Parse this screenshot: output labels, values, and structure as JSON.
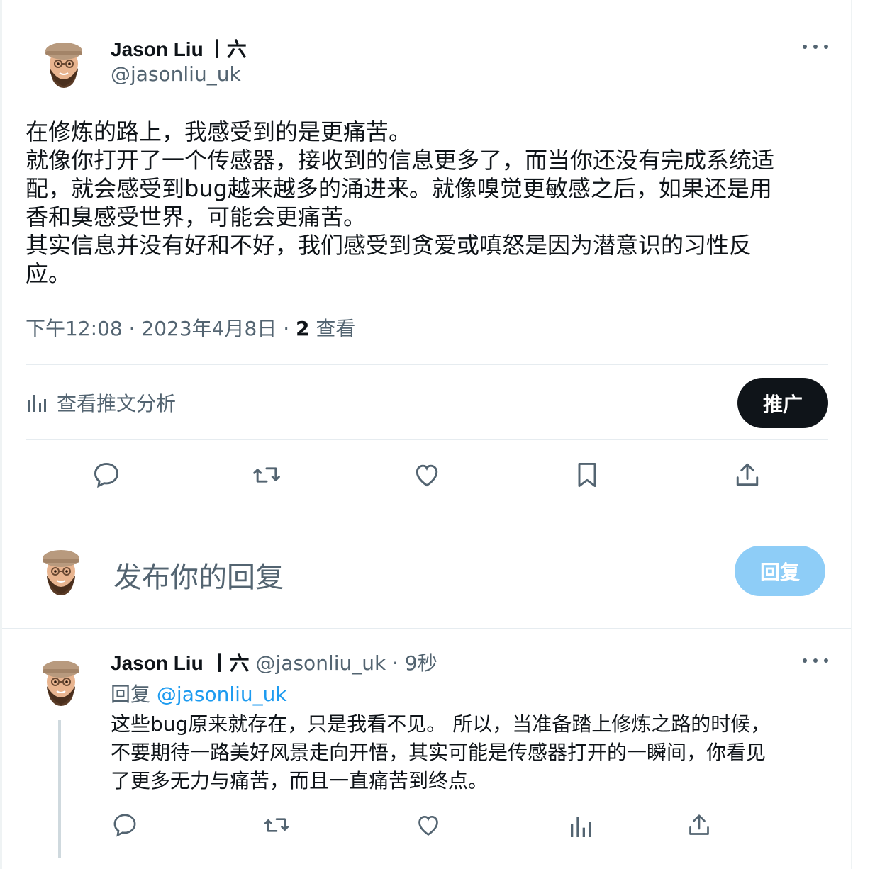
{
  "tweet": {
    "author_name": "Jason Liu",
    "author_suffix": "丨六",
    "author_handle": "@jasonliu_uk",
    "text": "在修炼的路上，我感受到的是更痛苦。\n就像你打开了一个传感器，接收到的信息更多了，而当你还没有完成系统适\n配，就会感受到bug越来越多的涌进来。就像嗅觉更敏感之后，如果还是用\n香和臭感受世界，可能会更痛苦。\n其实信息并没有好和不好，我们感受到贪爱或嗔怒是因为潜意识的习性反\n应。",
    "time": "下午12:08",
    "date": "2023年4月8日",
    "views_count": "2",
    "views_label": "查看"
  },
  "analytics": {
    "label": "查看推文分析",
    "promote_label": "推广"
  },
  "compose": {
    "placeholder": "发布你的回复",
    "reply_button": "回复"
  },
  "reply": {
    "author_name": "Jason Liu",
    "author_suffix": "丨六",
    "author_handle": "@jasonliu_uk",
    "age": "9秒",
    "replying_to_label": "回复",
    "replying_to_handle": "@jasonliu_uk",
    "text": "这些bug原来就存在，只是我看不见。 所以，当准备踏上修炼之路的时候，\n不要期待一路美好风景走向开悟，其实可能是传感器打开的一瞬间，你看见\n了更多无力与痛苦，而且一直痛苦到终点。"
  },
  "colors": {
    "accent": "#1d9bf0",
    "text_primary": "#0f1419",
    "text_secondary": "#536471",
    "promote_bg": "#0f1419",
    "reply_btn_bg": "#8ecdf7"
  }
}
